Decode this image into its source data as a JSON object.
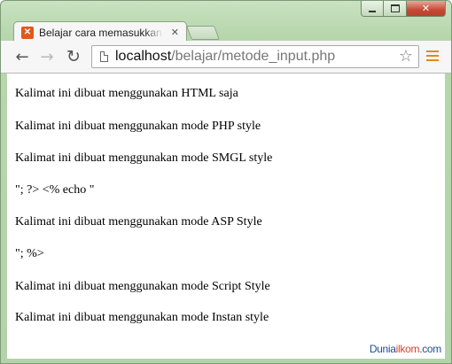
{
  "window": {
    "controls": {
      "minimize": "",
      "maximize": "",
      "close": "✕"
    }
  },
  "tab": {
    "title": "Belajar cara memasukkan",
    "favicon_icon": "xampp-icon",
    "close_label": "✕"
  },
  "toolbar": {
    "back_label": "←",
    "forward_label": "→",
    "reload_label": "↻",
    "url_host": "localhost",
    "url_path": "/belajar/metode_input.php",
    "star_label": "☆"
  },
  "content": {
    "lines": [
      "Kalimat ini dibuat menggunakan HTML saja",
      "Kalimat ini dibuat menggunakan mode PHP style",
      "Kalimat ini dibuat menggunakan mode SMGL style",
      "\"; ?> <% echo \"",
      "Kalimat ini dibuat menggunakan mode ASP Style",
      "\"; %>",
      "Kalimat ini dibuat menggunakan mode Script Style",
      "Kalimat ini dibuat menggunakan mode Instan style"
    ]
  },
  "watermark": {
    "part1": "Dunia",
    "part2": "ilkom",
    "part3": ".com"
  },
  "colors": {
    "accent_orange": "#e8861a",
    "frame_green": "#b6d6ac",
    "close_red": "#c44a36"
  }
}
